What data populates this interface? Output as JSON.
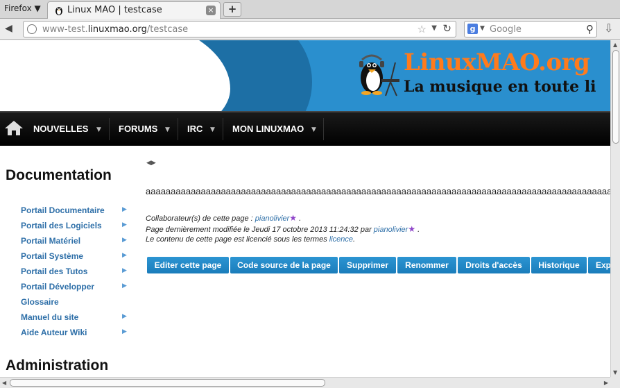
{
  "browser": {
    "menu_label": "Firefox ▼",
    "tab_title": "Linux MAO | testcase",
    "tab_close": "×",
    "new_tab": "+",
    "url_prefix": "www-test.",
    "url_domain": "linuxmao.org",
    "url_path": "/testcase",
    "search_placeholder": "Google",
    "search_engine": "g"
  },
  "banner": {
    "title": "LinuxMAO.org",
    "subtitle": "La musique en toute li"
  },
  "menu": [
    {
      "label": "NOUVELLES"
    },
    {
      "label": "FORUMS"
    },
    {
      "label": "IRC"
    },
    {
      "label": "MON LINUXMAO"
    }
  ],
  "sidebar": {
    "section1_title": "Documentation",
    "links": [
      {
        "label": "Portail Documentaire",
        "has_submenu": true
      },
      {
        "label": "Portail des Logiciels",
        "has_submenu": true
      },
      {
        "label": "Portail Matériel",
        "has_submenu": true
      },
      {
        "label": "Portail Système",
        "has_submenu": true
      },
      {
        "label": "Portail des Tutos",
        "has_submenu": true
      },
      {
        "label": "Portail Développer",
        "has_submenu": true
      },
      {
        "label": "Glossaire",
        "has_submenu": false
      },
      {
        "label": "Manuel du site",
        "has_submenu": true
      },
      {
        "label": "Aide Auteur Wiki",
        "has_submenu": true
      }
    ],
    "section2_title": "Administration"
  },
  "content": {
    "body_text": "aaaaaaaaaaaaaaaaaaaaaaaaaaaaaaaaaaaaaaaaaaaaaaaaaaaaaaaaaaaaaaaaaaaaaaaaaaaaaaaaaaaaaaaaaaaaaaaaaa",
    "contrib_label": "Collaborateur(s) de cette page : ",
    "contrib_user": "pianolivier",
    "contrib_end": " .",
    "modified_label": "Page dernièrement modifiée le Jeudi 17 octobre 2013 11:24:32 par ",
    "modified_user": "pianolivier",
    "modified_end": " .",
    "license_label": "Le contenu de cette page est licencié sous les termes ",
    "license_link": "licence",
    "license_end": "."
  },
  "actions": [
    {
      "label": "Editer cette page"
    },
    {
      "label": "Code source de la page"
    },
    {
      "label": "Supprimer"
    },
    {
      "label": "Renommer"
    },
    {
      "label": "Droits d'accès"
    },
    {
      "label": "Historique"
    },
    {
      "label": "Exp"
    }
  ],
  "colors": {
    "accent": "#1a7dbb",
    "link": "#2e6fa8",
    "logo_orange": "#ff7b1c"
  }
}
